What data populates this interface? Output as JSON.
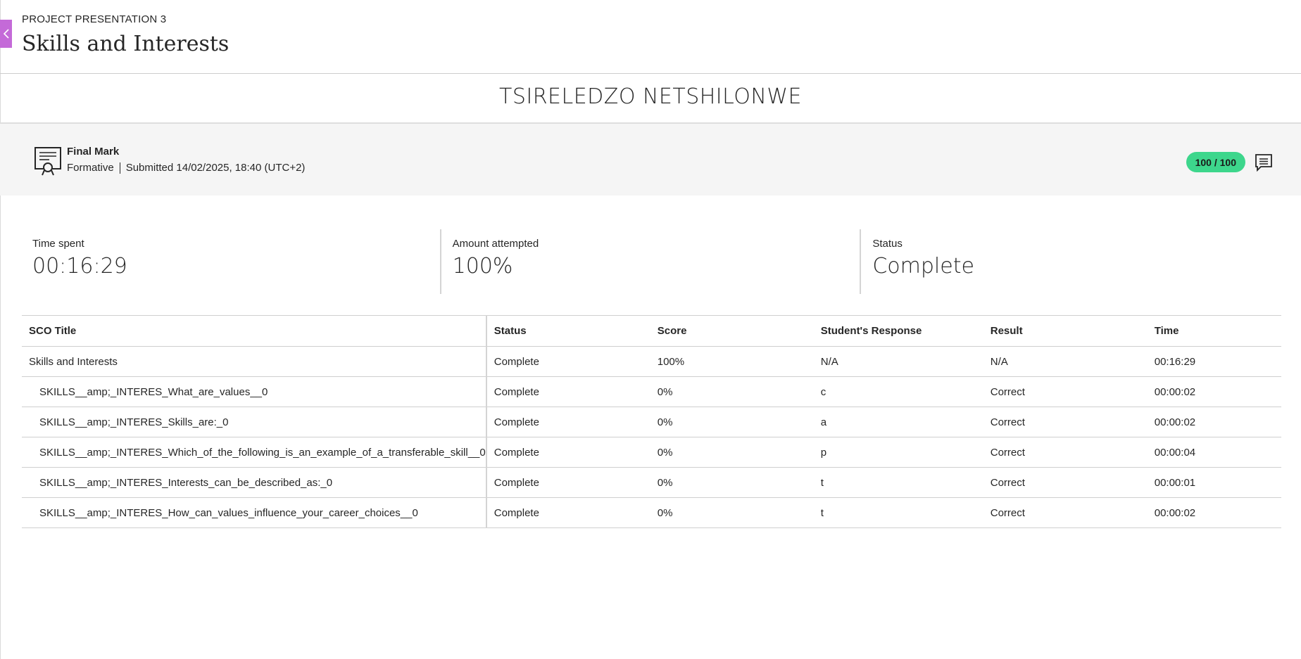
{
  "header": {
    "breadcrumb": "PROJECT PRESENTATION 3",
    "title": "Skills and Interests"
  },
  "student": {
    "name": "TSIRELEDZO NETSHILONWE"
  },
  "grade": {
    "title": "Final Mark",
    "type": "Formative",
    "submitted": "Submitted 14/02/2025, 18:40 (UTC+2)",
    "score": "100 / 100",
    "pill_color": "#3dd68c"
  },
  "stats": {
    "time_label": "Time spent",
    "time_value": "00:16:29",
    "attempted_label": "Amount attempted",
    "attempted_value": "100%",
    "status_label": "Status",
    "status_value": "Complete"
  },
  "table": {
    "headers": [
      "SCO Title",
      "Status",
      "Score",
      "Student's Response",
      "Result",
      "Time"
    ],
    "rows": [
      [
        "Skills and Interests",
        "Complete",
        "100%",
        "N/A",
        "N/A",
        "00:16:29"
      ],
      [
        "SKILLS__amp;_INTERES_What_are_values__0",
        "Complete",
        "0%",
        "c",
        "Correct",
        "00:00:02"
      ],
      [
        "SKILLS__amp;_INTERES_Skills_are:_0",
        "Complete",
        "0%",
        "a",
        "Correct",
        "00:00:02"
      ],
      [
        "SKILLS__amp;_INTERES_Which_of_the_following_is_an_example_of_a_transferable_skill__0",
        "Complete",
        "0%",
        "p",
        "Correct",
        "00:00:04"
      ],
      [
        "SKILLS__amp;_INTERES_Interests_can_be_described_as:_0",
        "Complete",
        "0%",
        "t",
        "Correct",
        "00:00:01"
      ],
      [
        "SKILLS__amp;_INTERES_How_can_values_influence_your_career_choices__0",
        "Complete",
        "0%",
        "t",
        "Correct",
        "00:00:02"
      ]
    ]
  },
  "icons": {
    "back": "chevron-left-icon",
    "grade": "certificate-icon",
    "comment": "comment-icon"
  },
  "colors": {
    "accent": "#c46ad8",
    "grade_pill": "#3dd68c"
  }
}
